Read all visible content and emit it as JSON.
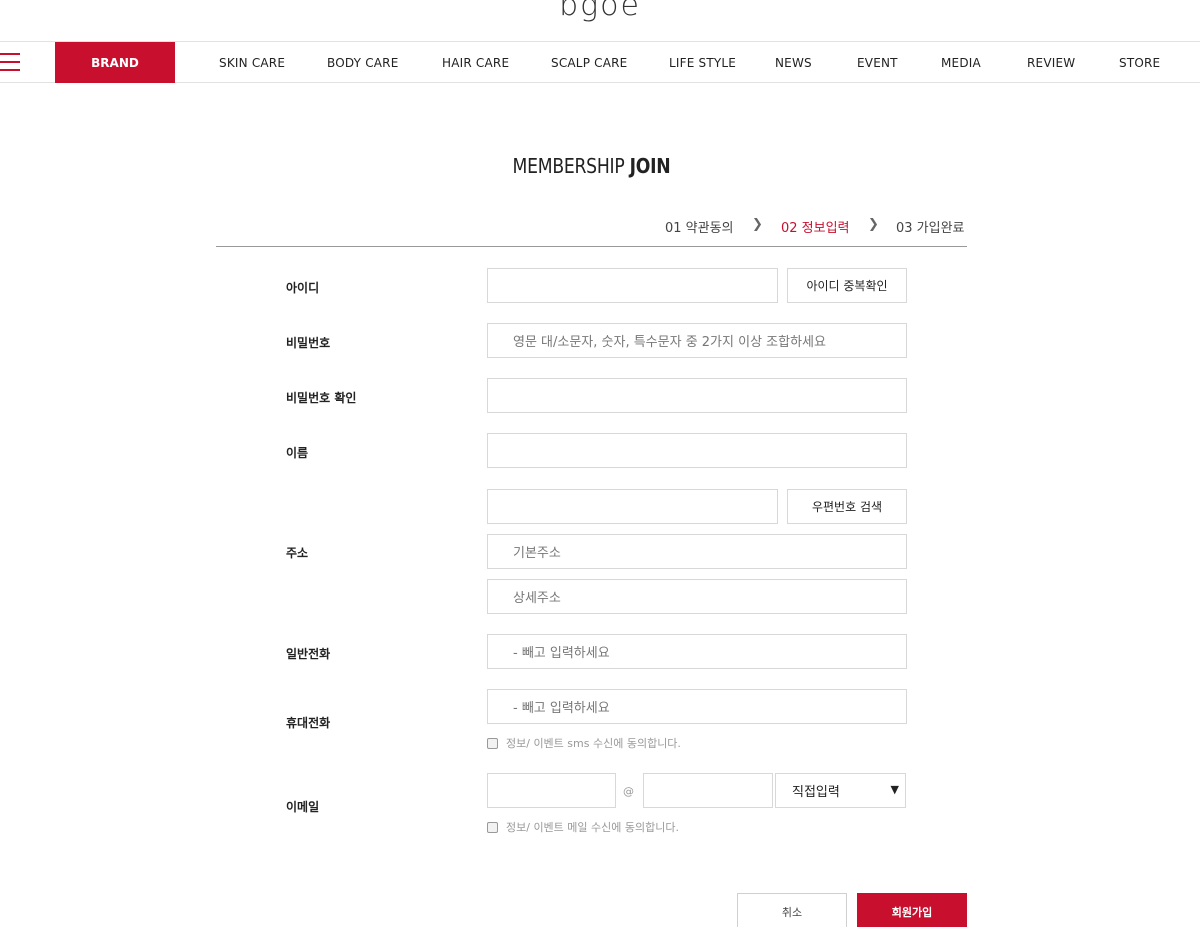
{
  "header": {
    "logo": "bgoe",
    "nav": {
      "brand": "BRAND",
      "items": [
        "SKIN CARE",
        "BODY CARE",
        "HAIR CARE",
        "SCALP CARE",
        "LIFE STYLE",
        "NEWS",
        "EVENT",
        "MEDIA",
        "REVIEW",
        "STORE"
      ]
    }
  },
  "page": {
    "title_light": "MEMBERSHIP ",
    "title_bold": "JOIN"
  },
  "steps": [
    {
      "label": "01 약관동의",
      "active": false
    },
    {
      "label": "02 정보입력",
      "active": true
    },
    {
      "label": "03 가입완료",
      "active": false
    }
  ],
  "form": {
    "id_label": "아이디",
    "id_check_button": "아이디 중복확인",
    "password_label": "비밀번호",
    "password_placeholder": "영문 대/소문자, 숫자, 특수문자 중 2가지 이상 조합하세요",
    "password_confirm_label": "비밀번호 확인",
    "name_label": "이름",
    "address_label": "주소",
    "zipcode_button": "우편번호 검색",
    "address_basic_placeholder": "기본주소",
    "address_detail_placeholder": "상세주소",
    "phone_label": "일반전화",
    "phone_placeholder": "- 빼고 입력하세요",
    "mobile_label": "휴대전화",
    "mobile_placeholder": "- 빼고 입력하세요",
    "sms_agree": "정보/ 이벤트 sms 수신에 동의합니다.",
    "email_label": "이메일",
    "email_at": "@",
    "email_domain_select": "직접입력",
    "email_agree": "정보/ 이벤트 메일 수신에 동의합니다."
  },
  "actions": {
    "cancel": "취소",
    "join": "회원가입"
  },
  "colors": {
    "accent": "#c8102e"
  }
}
